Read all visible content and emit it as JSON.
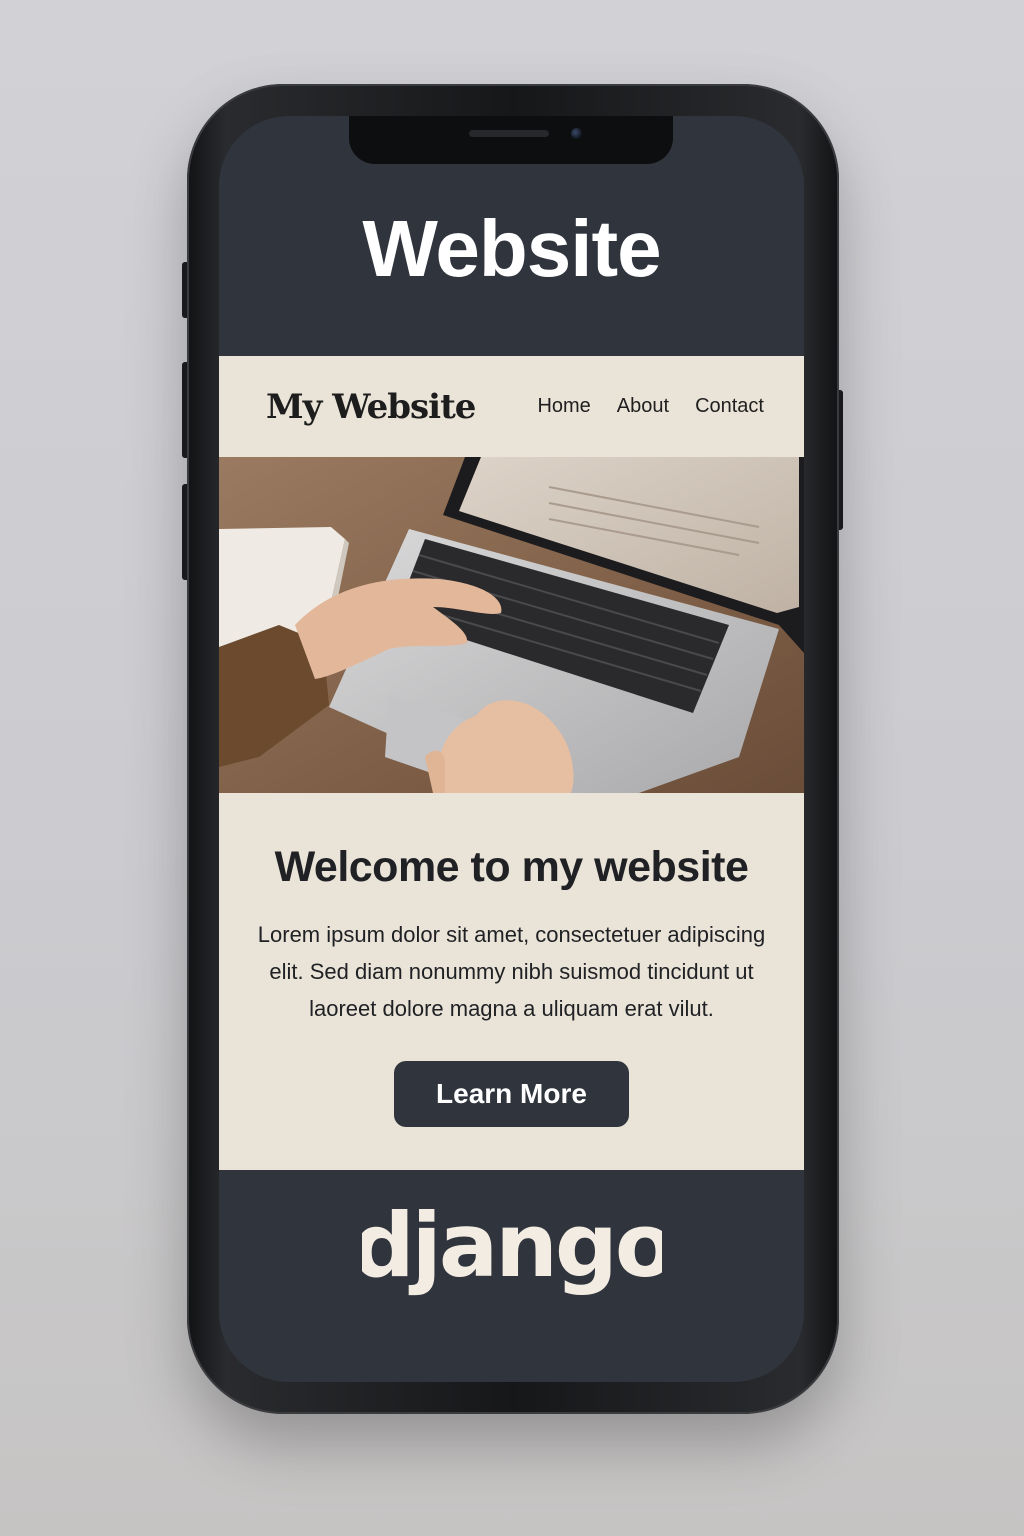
{
  "banner": {
    "title": "Website"
  },
  "site": {
    "logo": "My Website",
    "nav": [
      {
        "label": "Home"
      },
      {
        "label": "About"
      },
      {
        "label": "Contact"
      }
    ]
  },
  "hero_image": {
    "subject": "hands typing on laptop keyboard"
  },
  "content": {
    "headline": "Welcome to my website",
    "body": "Lorem ipsum dolor sit amet, consectetuer adipiscing elit. Sed diam nonummy nibh suismod tincidunt ut laoreet dolore magna a uliquam erat vilut.",
    "button_label": "Learn More"
  },
  "footer": {
    "logo_text": "django"
  },
  "colors": {
    "dark": "#2f343d",
    "cream": "#eae3d8",
    "text": "#1f2124",
    "logo_cream": "#f3ece2"
  }
}
